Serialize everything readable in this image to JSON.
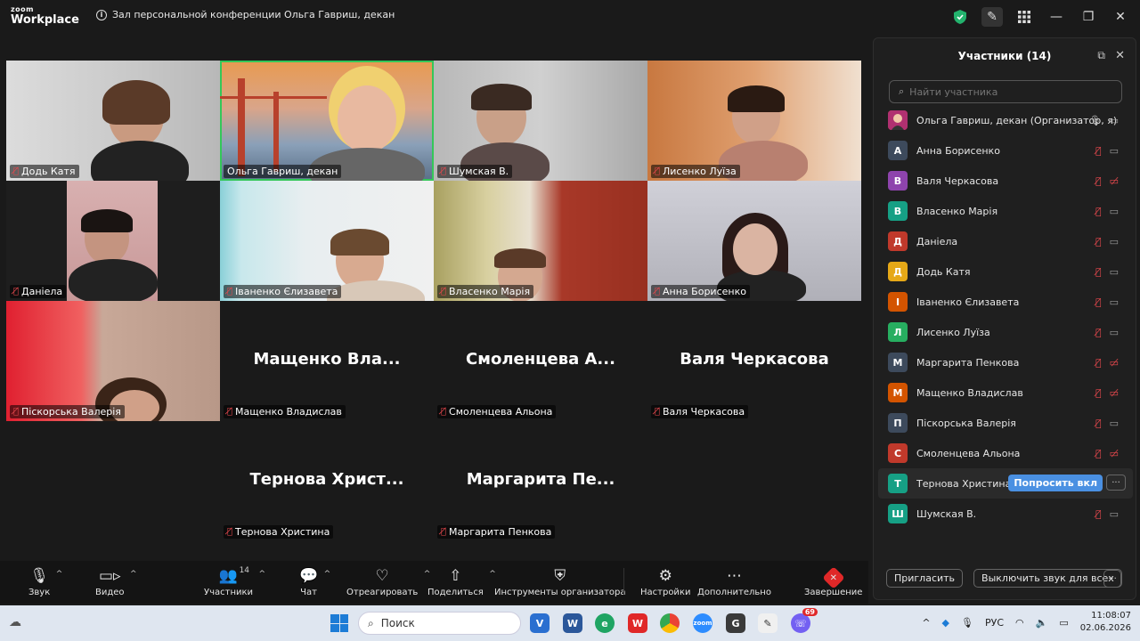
{
  "app": {
    "logo_line1": "zoom",
    "logo_line2": "Workplace",
    "meeting_title": "Зал персональной конференции Ольга Гавриш, декан"
  },
  "gallery": {
    "video_tiles": [
      {
        "name": "Додь Катя"
      },
      {
        "name": "Ольга Гавриш, декан"
      },
      {
        "name": "Шумская В."
      },
      {
        "name": "Лисенко Луїза"
      },
      {
        "name": "Даніела"
      },
      {
        "name": "Іваненко Єлизавета"
      },
      {
        "name": "Власенко Марія"
      },
      {
        "name": "Анна Борисенко"
      },
      {
        "name": "Піскорська Валерія"
      }
    ],
    "name_tiles": [
      {
        "big": "Мащенко Вла...",
        "name": "Мащенко Владислав"
      },
      {
        "big": "Смоленцева А...",
        "name": "Смоленцева Альона"
      },
      {
        "big": "Валя Черкасова",
        "name": "Валя Черкасова"
      },
      {
        "big": "Тернова Христ...",
        "name": "Тернова Христина"
      },
      {
        "big": "Маргарита Пе...",
        "name": "Маргарита Пенкова"
      }
    ]
  },
  "panel": {
    "title": "Участники (14)",
    "search_placeholder": "Найти участника",
    "participants": [
      {
        "initial": "",
        "name": "Ольга Гавриш, декан (Организатор, я)",
        "color": "#c0392b"
      },
      {
        "initial": "А",
        "name": "Анна Борисенко",
        "color": "#3d4a5c"
      },
      {
        "initial": "В",
        "name": "Валя Черкасова",
        "color": "#8e44ad"
      },
      {
        "initial": "В",
        "name": "Власенко Марія",
        "color": "#16a085"
      },
      {
        "initial": "Д",
        "name": "Даніела",
        "color": "#c0392b"
      },
      {
        "initial": "Д",
        "name": "Додь Катя",
        "color": "#e6a817"
      },
      {
        "initial": "І",
        "name": "Іваненко Єлизавета",
        "color": "#d35400"
      },
      {
        "initial": "Л",
        "name": "Лисенко Луїза",
        "color": "#27ae60"
      },
      {
        "initial": "М",
        "name": "Маргарита Пенкова",
        "color": "#3d4a5c"
      },
      {
        "initial": "М",
        "name": "Мащенко Владислав",
        "color": "#d35400"
      },
      {
        "initial": "П",
        "name": "Піскорська Валерія",
        "color": "#3d4a5c"
      },
      {
        "initial": "С",
        "name": "Смоленцева Альона",
        "color": "#c0392b"
      },
      {
        "initial": "Т",
        "name": "Тернова Христина",
        "color": "#16a085"
      },
      {
        "initial": "Ш",
        "name": "Шумская В.",
        "color": "#16a085"
      }
    ],
    "ask_button": "Попросить вкл",
    "more_button": "···",
    "invite_button": "Пригласить",
    "mute_all_button": "Выключить звук для всех"
  },
  "toolbar": {
    "audio": "Звук",
    "video": "Видео",
    "participants": "Участники",
    "participants_count": "14",
    "chat": "Чат",
    "react": "Отреагировать",
    "share": "Поделиться",
    "host_tools": "Инструменты организатора",
    "settings": "Настройки",
    "more": "Дополнительно",
    "end": "Завершение"
  },
  "taskbar": {
    "search": "Поиск",
    "lang": "РУС",
    "time": "11:08:07",
    "date": "02.06.2026",
    "viber_badge": "69"
  }
}
